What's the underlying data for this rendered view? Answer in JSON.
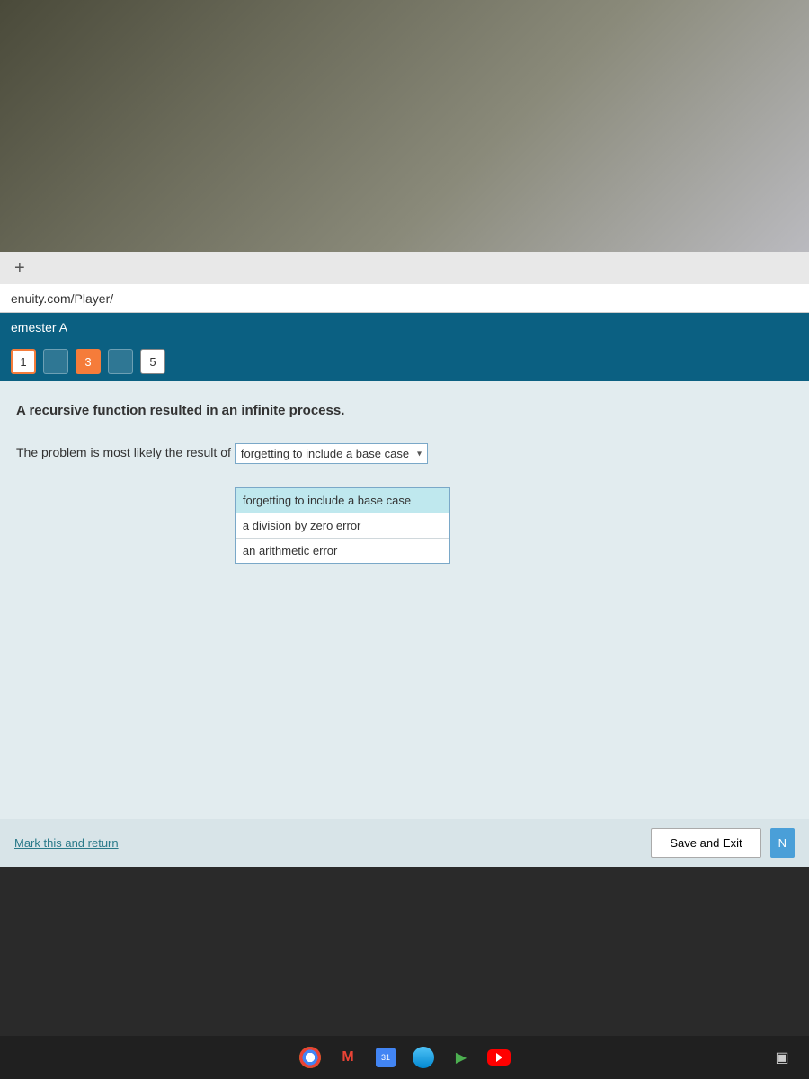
{
  "browser": {
    "url": "enuity.com/Player/",
    "new_tab": "+"
  },
  "header": {
    "title": "emester A"
  },
  "nav": {
    "items": [
      {
        "label": "1",
        "state": "outlined"
      },
      {
        "label": "",
        "state": "dim"
      },
      {
        "label": "3",
        "state": "active"
      },
      {
        "label": "",
        "state": "dim"
      },
      {
        "label": "5",
        "state": "default"
      }
    ]
  },
  "question": {
    "title": "A recursive function resulted in an infinite process.",
    "prompt": "The problem is most likely the result of",
    "selected": "forgetting to include a base case",
    "options": [
      "forgetting to include a base case",
      "a division by zero error",
      "an arithmetic error"
    ]
  },
  "footer": {
    "mark_return": "Mark this and return",
    "save_exit": "Save and Exit",
    "next": "N"
  },
  "taskbar": {
    "calendar": "31"
  }
}
